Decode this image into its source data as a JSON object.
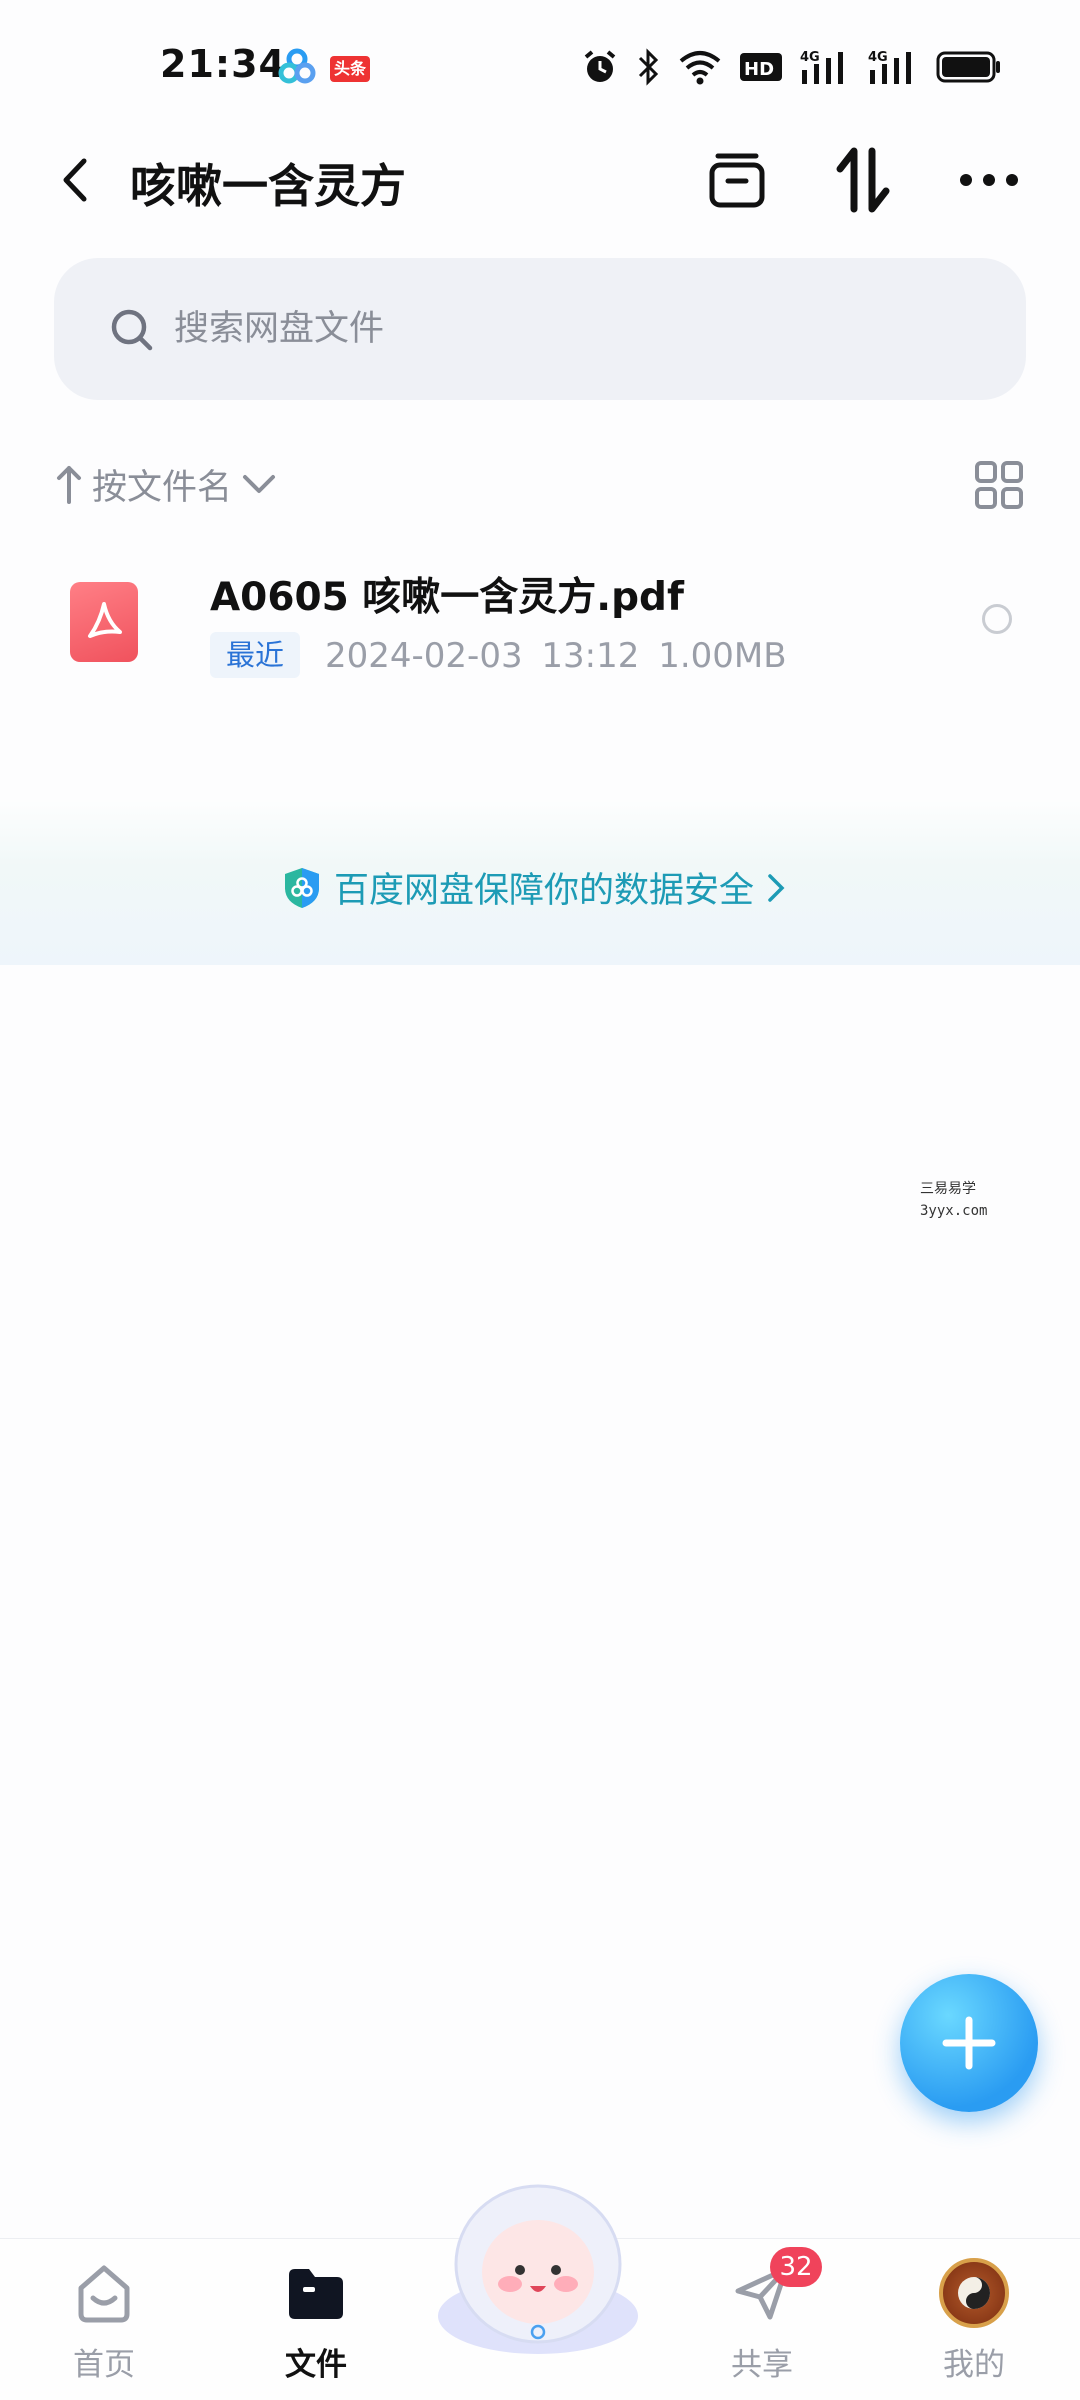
{
  "status_bar": {
    "time": "21:34",
    "app_badge": "头条"
  },
  "header": {
    "title": "咳嗽一含灵方"
  },
  "search": {
    "placeholder": "搜索网盘文件"
  },
  "sort": {
    "label": "按文件名"
  },
  "files": [
    {
      "name": "A0605 咳嗽一含灵方.pdf",
      "tag": "最近",
      "meta": "2024-02-03  13:12  1.00MB",
      "icon": "pdf-icon"
    }
  ],
  "banner": {
    "text": "百度网盘保障你的数据安全"
  },
  "watermark": {
    "line1": "三易易学",
    "line2": "3yyx.com"
  },
  "nav": {
    "items": [
      {
        "label": "首页",
        "icon": "home-icon"
      },
      {
        "label": "文件",
        "icon": "folder-icon"
      },
      {
        "label": "共享",
        "icon": "share-icon",
        "badge": "32"
      },
      {
        "label": "我的",
        "icon": "avatar"
      }
    ]
  },
  "colors": {
    "accent": "#2a9cf2",
    "banner_text": "#1d9bb5",
    "badge": "#f0435b",
    "pdf": "#f0525d"
  }
}
